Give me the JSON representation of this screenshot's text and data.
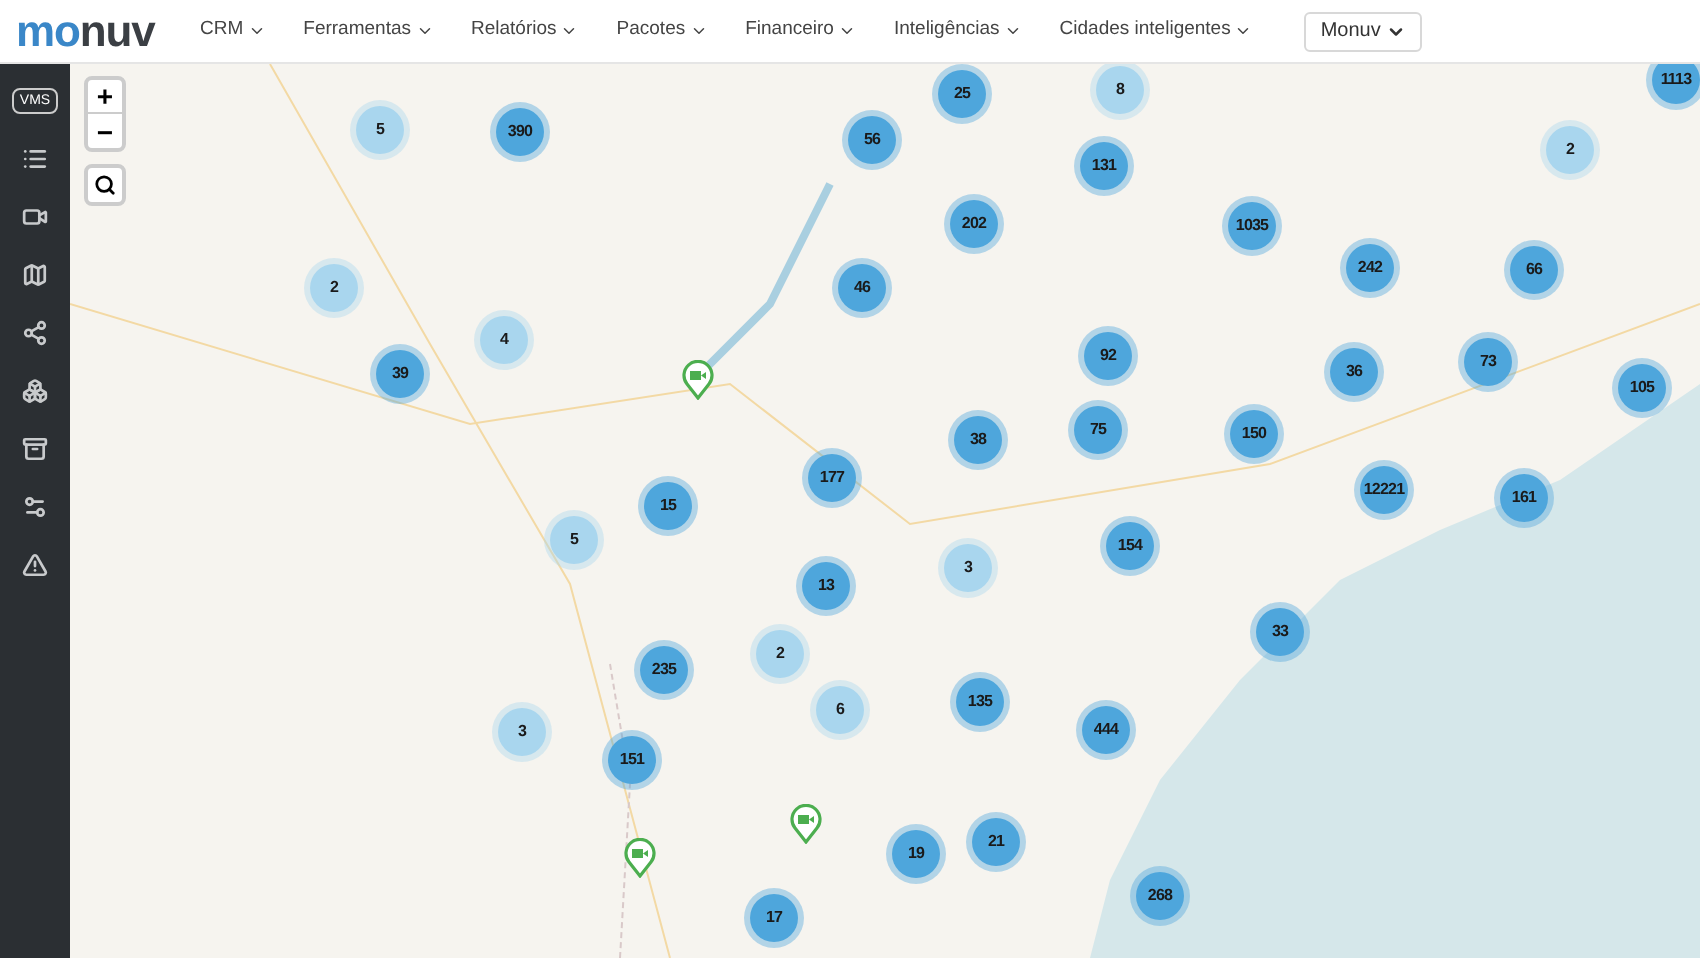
{
  "navbar": {
    "logo": [
      {
        "text": "mo",
        "color": "#3a87c8"
      },
      {
        "text": "nuv",
        "color": "#3b3f44"
      }
    ],
    "menu": [
      {
        "label": "CRM"
      },
      {
        "label": "Ferramentas"
      },
      {
        "label": "Relatórios"
      },
      {
        "label": "Pacotes"
      },
      {
        "label": "Financeiro"
      },
      {
        "label": "Inteligências"
      },
      {
        "label": "Cidades inteligentes"
      }
    ],
    "account_select": {
      "value": "Monuv"
    }
  },
  "sidebar": {
    "badge": "VMS"
  },
  "map": {
    "zoom_in": "+",
    "zoom_out": "−",
    "clusters": [
      {
        "count": "5",
        "color": "#a9d6ee"
      },
      {
        "count": "390",
        "color": "#4ea6dc"
      },
      {
        "count": "2",
        "color": "#a9d6ee"
      },
      {
        "count": "39",
        "color": "#4ea6dc"
      },
      {
        "count": "4",
        "color": "#a9d6ee"
      },
      {
        "count": "5",
        "color": "#a9d6ee"
      },
      {
        "count": "3",
        "color": "#a9d6ee"
      },
      {
        "count": "151",
        "color": "#4ea6dc"
      },
      {
        "count": "235",
        "color": "#4ea6dc"
      },
      {
        "count": "15",
        "color": "#4ea6dc"
      },
      {
        "count": "2",
        "color": "#a9d6ee"
      },
      {
        "count": "6",
        "color": "#a9d6ee"
      },
      {
        "count": "13",
        "color": "#4ea6dc"
      },
      {
        "count": "177",
        "color": "#4ea6dc"
      },
      {
        "count": "46",
        "color": "#4ea6dc"
      },
      {
        "count": "56",
        "color": "#4ea6dc"
      },
      {
        "count": "25",
        "color": "#4ea6dc"
      },
      {
        "count": "8",
        "color": "#a9d6ee"
      },
      {
        "count": "202",
        "color": "#4ea6dc"
      },
      {
        "count": "131",
        "color": "#4ea6dc"
      },
      {
        "count": "3",
        "color": "#a9d6ee"
      },
      {
        "count": "38",
        "color": "#4ea6dc"
      },
      {
        "count": "135",
        "color": "#4ea6dc"
      },
      {
        "count": "444",
        "color": "#4ea6dc"
      },
      {
        "count": "19",
        "color": "#4ea6dc"
      },
      {
        "count": "21",
        "color": "#4ea6dc"
      },
      {
        "count": "17",
        "color": "#4ea6dc"
      },
      {
        "count": "268",
        "color": "#4ea6dc"
      },
      {
        "count": "154",
        "color": "#4ea6dc"
      },
      {
        "count": "75",
        "color": "#4ea6dc"
      },
      {
        "count": "92",
        "color": "#4ea6dc"
      },
      {
        "count": "1035",
        "color": "#4ea6dc"
      },
      {
        "count": "150",
        "color": "#4ea6dc"
      },
      {
        "count": "33",
        "color": "#4ea6dc"
      },
      {
        "count": "242",
        "color": "#4ea6dc"
      },
      {
        "count": "36",
        "color": "#4ea6dc"
      },
      {
        "count": "12221",
        "color": "#4ea6dc"
      },
      {
        "count": "73",
        "color": "#4ea6dc"
      },
      {
        "count": "161",
        "color": "#4ea6dc"
      },
      {
        "count": "66",
        "color": "#4ea6dc"
      },
      {
        "count": "2",
        "color": "#a9d6ee"
      },
      {
        "count": "105",
        "color": "#4ea6dc"
      },
      {
        "count": "1113",
        "color": "#4ea6dc"
      }
    ]
  }
}
